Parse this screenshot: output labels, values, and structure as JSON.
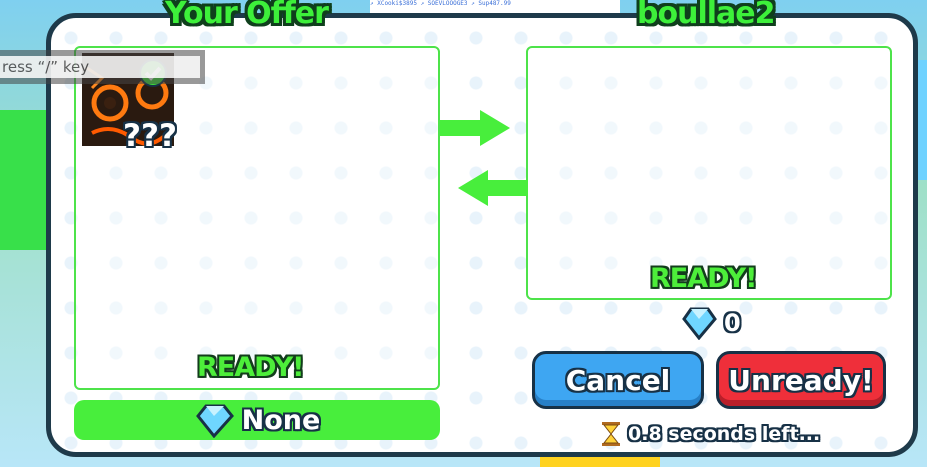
{
  "background_sign_text": "↗ XCooki$3895   ↗ SOEVLOOOGE3  ↗ Sup487.99",
  "tooltip": {
    "text": "ress “/” key"
  },
  "left_title": "Your Offer",
  "right_title": "boullae2",
  "left_panel": {
    "item": {
      "label": "???",
      "icon": "lava-pet-icon",
      "selected": true
    },
    "ready_label": "READY!",
    "gems_label": "None"
  },
  "right_panel": {
    "ready_label": "READY!",
    "gems_value": "0"
  },
  "buttons": {
    "cancel": "Cancel",
    "unready": "Unready!"
  },
  "timer_text": "0.8 seconds left...",
  "colors": {
    "green": "#48ee3c",
    "blue_button": "#3ea6f2",
    "red_button": "#ef2f3a",
    "outline": "#173146"
  }
}
